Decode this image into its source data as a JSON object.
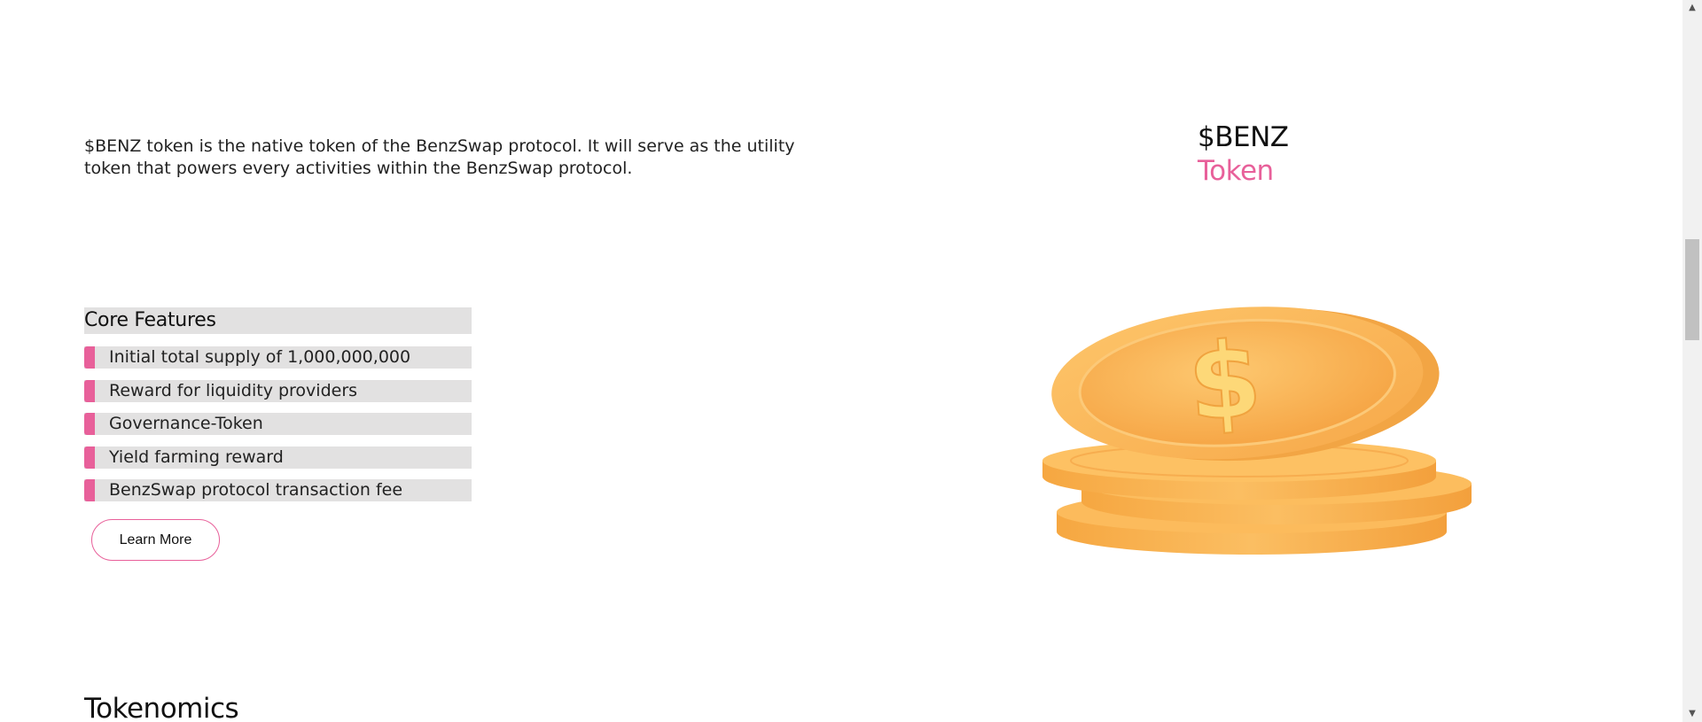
{
  "intro": {
    "text": "$BENZ token is the native token of the BenzSwap protocol. It will serve as the utility token that powers every activities within the BenzSwap protocol."
  },
  "token_title": {
    "line1": "$BENZ",
    "line2": "Token"
  },
  "features": {
    "heading": "Core Features",
    "items": [
      {
        "label": "Initial total supply of 1,000,000,000"
      },
      {
        "label": "Reward for liquidity providers"
      },
      {
        "label": "Governance-Token"
      },
      {
        "label": "Yield farming reward"
      },
      {
        "label": "BenzSwap protocol transaction fee"
      }
    ]
  },
  "learn_more": {
    "label": "Learn More"
  },
  "tokenomics": {
    "heading": "Tokenomics"
  },
  "coin_art": {
    "symbol": "$"
  },
  "scrollbar": {
    "up_icon": "▲",
    "down_icon": "▼"
  },
  "colors": {
    "accent": "#e8609a",
    "coin": "#fbb24e",
    "feature_bg": "#e2e1e1"
  }
}
